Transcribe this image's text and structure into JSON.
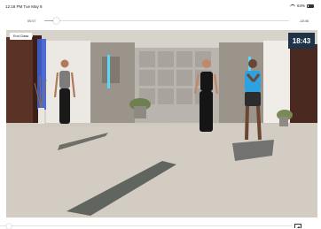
{
  "status_bar": {
    "time": "12:18 PM  Tue May 8",
    "signal_text": "64%"
  },
  "playback": {
    "elapsed": "00:07",
    "remaining": "-18:46",
    "progress_fraction": 0.05
  },
  "video": {
    "end_class_label": "End Class",
    "timer": "18:43"
  },
  "colors": {
    "timer_bg": "#1f3349",
    "accent": "#1e90ff"
  },
  "icons": {
    "wifi": "wifi-icon",
    "battery": "battery-icon",
    "airplay": "airplay-icon"
  }
}
